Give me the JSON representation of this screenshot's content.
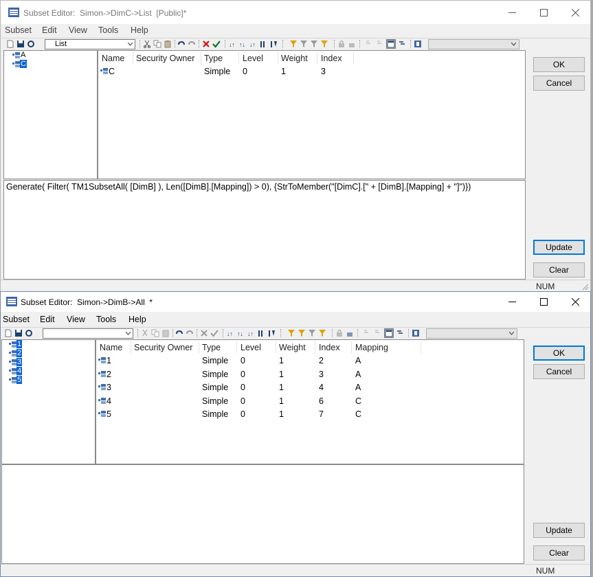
{
  "windows": [
    {
      "title": "Subset Editor:  Simon->DimC->List  [Public]*",
      "menu": [
        "Subset",
        "Edit",
        "View",
        "Tools",
        "Help"
      ],
      "toolbar_combo": "List",
      "tree": [
        {
          "label": "A",
          "selected": false
        },
        {
          "label": "C",
          "selected": true
        }
      ],
      "columns": [
        "Name",
        "Security Owner",
        "Type",
        "Level",
        "Weight",
        "Index"
      ],
      "rows": [
        [
          "C",
          "",
          "Simple",
          "0",
          "1",
          "3"
        ]
      ],
      "expression": "Generate( Filter( TM1SubsetAll( [DimB] ), Len([DimB].[Mapping]) > 0), {StrToMember(\"[DimC].[\" + [DimB].[Mapping] + \"]\")})",
      "buttons": {
        "ok": "OK",
        "cancel": "Cancel",
        "update": "Update",
        "clear": "Clear"
      },
      "status": "NUM"
    },
    {
      "title": "Subset Editor:  Simon->DimB->All  *",
      "menu": [
        "Subset",
        "Edit",
        "View",
        "Tools",
        "Help"
      ],
      "toolbar_combo": "",
      "tree": [
        {
          "label": "1",
          "selected": true
        },
        {
          "label": "2",
          "selected": true
        },
        {
          "label": "3",
          "selected": true
        },
        {
          "label": "4",
          "selected": true
        },
        {
          "label": "5",
          "selected": true
        }
      ],
      "columns": [
        "Name",
        "Security Owner",
        "Type",
        "Level",
        "Weight",
        "Index",
        "Mapping"
      ],
      "rows": [
        [
          "1",
          "",
          "Simple",
          "0",
          "1",
          "2",
          "A"
        ],
        [
          "2",
          "",
          "Simple",
          "0",
          "1",
          "3",
          "A"
        ],
        [
          "3",
          "",
          "Simple",
          "0",
          "1",
          "4",
          "A"
        ],
        [
          "4",
          "",
          "Simple",
          "0",
          "1",
          "6",
          "C"
        ],
        [
          "5",
          "",
          "Simple",
          "0",
          "1",
          "7",
          "C"
        ]
      ],
      "expression": "",
      "buttons": {
        "ok": "OK",
        "cancel": "Cancel",
        "update": "Update",
        "clear": "Clear"
      },
      "status": "NUM"
    }
  ],
  "colors": {
    "selection": "#0a64d6",
    "default_button_border": "#0078d7",
    "element_icon": "#3f6fae"
  },
  "icons": [
    "app-icon",
    "minimize-icon",
    "maximize-icon",
    "close-icon",
    "element-icon",
    "cut-icon",
    "copy-icon",
    "paste-icon",
    "undo-icon",
    "redo-icon",
    "delete-icon",
    "checkmark-icon",
    "sort-icon",
    "filter-icon",
    "dropdown-arrow-icon"
  ]
}
